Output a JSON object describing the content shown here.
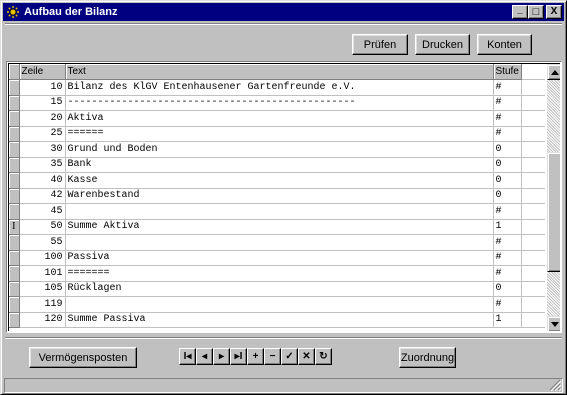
{
  "window": {
    "title": "Aufbau der Bilanz",
    "controls": {
      "minimize": "_",
      "maximize": "□",
      "close": "X"
    }
  },
  "toolbar": {
    "pruefen_label": "Prüfen",
    "drucken_label": "Drucken",
    "konten_label": "Konten"
  },
  "grid": {
    "columns": {
      "zeile": "Zeile",
      "text": "Text",
      "stufe": "Stufe"
    },
    "current_row_marker": "I",
    "rows": [
      {
        "zeile": "10",
        "text": "Bilanz des KlGV Entenhausener Gartenfreunde e.V.",
        "stufe": "#"
      },
      {
        "zeile": "15",
        "text": "------------------------------------------------",
        "stufe": "#"
      },
      {
        "zeile": "20",
        "text": "Aktiva",
        "stufe": "#"
      },
      {
        "zeile": "25",
        "text": "======",
        "stufe": "#"
      },
      {
        "zeile": "30",
        "text": "Grund und Boden",
        "stufe": "0"
      },
      {
        "zeile": "35",
        "text": "Bank",
        "stufe": "0"
      },
      {
        "zeile": "40",
        "text": "Kasse",
        "stufe": "0"
      },
      {
        "zeile": "42",
        "text": "Warenbestand",
        "stufe": "0"
      },
      {
        "zeile": "45",
        "text": "",
        "stufe": "#"
      },
      {
        "zeile": "50",
        "text": "Summe Aktiva",
        "stufe": "1"
      },
      {
        "zeile": "55",
        "text": "",
        "stufe": "#"
      },
      {
        "zeile": "100",
        "text": "Passiva",
        "stufe": "#"
      },
      {
        "zeile": "101",
        "text": "=======",
        "stufe": "#"
      },
      {
        "zeile": "105",
        "text": "Rücklagen",
        "stufe": "0"
      },
      {
        "zeile": "119",
        "text": "",
        "stufe": "#"
      },
      {
        "zeile": "120",
        "text": "Summe Passiva",
        "stufe": "1"
      }
    ]
  },
  "footer": {
    "vermoegensposten_label": "Vermögensposten",
    "zuordnung_label": "Zuordnung"
  },
  "navigator": [
    {
      "name": "nav-first-button",
      "glyph": "I◂"
    },
    {
      "name": "nav-prior-button",
      "glyph": "◂"
    },
    {
      "name": "nav-next-button",
      "glyph": "▸"
    },
    {
      "name": "nav-last-button",
      "glyph": "▸I"
    },
    {
      "name": "nav-insert-button",
      "glyph": "+"
    },
    {
      "name": "nav-delete-button",
      "glyph": "−"
    },
    {
      "name": "nav-post-button",
      "glyph": "✓"
    },
    {
      "name": "nav-cancel-button",
      "glyph": "✕"
    },
    {
      "name": "nav-refresh-button",
      "glyph": "↻"
    }
  ],
  "colors": {
    "titlebar": "#000080",
    "face": "#c0c0c0",
    "icon": "#e0c000"
  }
}
